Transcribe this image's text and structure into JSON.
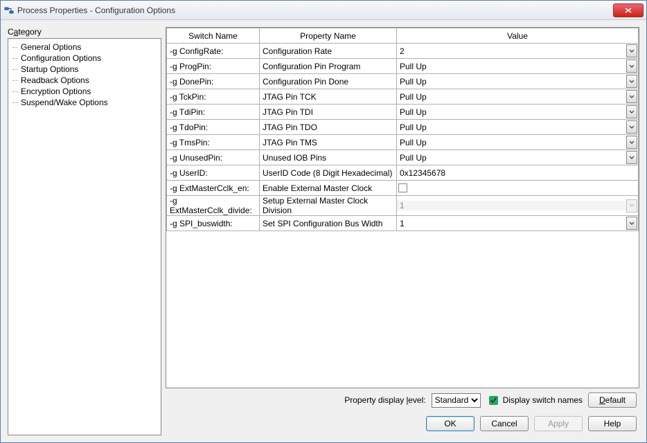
{
  "window": {
    "title": "Process Properties - Configuration Options"
  },
  "category": {
    "label_pre": "C",
    "label_ul": "a",
    "label_post": "tegory",
    "items": [
      "General Options",
      "Configuration Options",
      "Startup Options",
      "Readback Options",
      "Encryption Options",
      "Suspend/Wake Options"
    ],
    "selected_index": 1
  },
  "grid": {
    "headers": {
      "switch": "Switch Name",
      "property": "Property Name",
      "value": "Value"
    },
    "rows": [
      {
        "switch": "-g ConfigRate:",
        "property": "Configuration Rate",
        "value": "2",
        "type": "dropdown",
        "enabled": true
      },
      {
        "switch": "-g ProgPin:",
        "property": "Configuration Pin Program",
        "value": "Pull Up",
        "type": "dropdown",
        "enabled": true
      },
      {
        "switch": "-g DonePin:",
        "property": "Configuration Pin Done",
        "value": "Pull Up",
        "type": "dropdown",
        "enabled": true
      },
      {
        "switch": "-g TckPin:",
        "property": "JTAG Pin TCK",
        "value": "Pull Up",
        "type": "dropdown",
        "enabled": true
      },
      {
        "switch": "-g TdiPin:",
        "property": "JTAG Pin TDI",
        "value": "Pull Up",
        "type": "dropdown",
        "enabled": true
      },
      {
        "switch": "-g TdoPin:",
        "property": "JTAG Pin TDO",
        "value": "Pull Up",
        "type": "dropdown",
        "enabled": true
      },
      {
        "switch": "-g TmsPin:",
        "property": "JTAG Pin TMS",
        "value": "Pull Up",
        "type": "dropdown",
        "enabled": true
      },
      {
        "switch": "-g UnusedPin:",
        "property": "Unused IOB Pins",
        "value": "Pull Up",
        "type": "dropdown",
        "enabled": true
      },
      {
        "switch": "-g UserID:",
        "property": "UserID Code (8 Digit Hexadecimal)",
        "value": "0x12345678",
        "type": "text",
        "enabled": true
      },
      {
        "switch": "-g ExtMasterCclk_en:",
        "property": "Enable External Master Clock",
        "value": "",
        "type": "checkbox",
        "enabled": true,
        "checked": false
      },
      {
        "switch": "-g ExtMasterCclk_divide:",
        "property": "Setup External Master Clock Division",
        "value": "1",
        "type": "dropdown",
        "enabled": false
      },
      {
        "switch": "-g SPI_buswidth:",
        "property": "Set SPI Configuration Bus Width",
        "value": "1",
        "type": "dropdown",
        "enabled": true
      }
    ]
  },
  "footer": {
    "level_label_pre": "Property display ",
    "level_label_ul": "l",
    "level_label_post": "evel:",
    "level_value": "Standard",
    "display_switch_names_label_pre": "Display switch ",
    "display_switch_names_label_ul": "n",
    "display_switch_names_label_post": "ames",
    "display_switch_names_checked": true,
    "default": "Default",
    "ok": "OK",
    "cancel": "Cancel",
    "apply": "Apply",
    "help": "Help"
  }
}
